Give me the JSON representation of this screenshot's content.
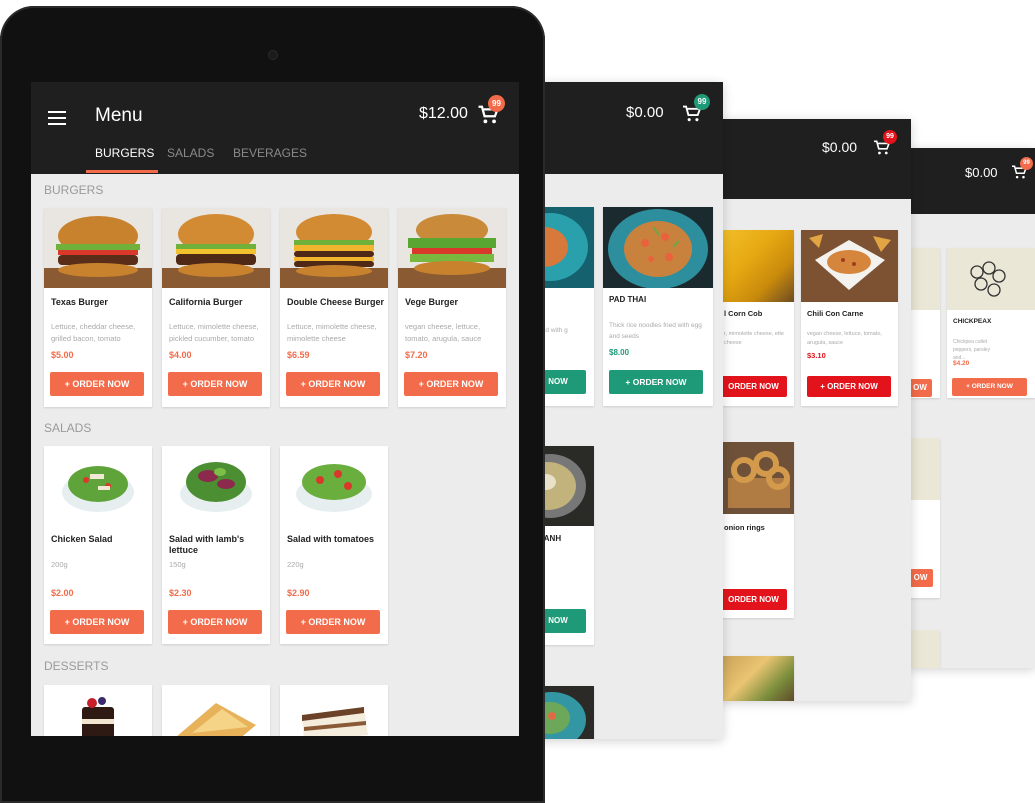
{
  "main": {
    "title": "Menu",
    "cart_total": "$12.00",
    "cart_badge": "99",
    "tabs": [
      "BURGERS",
      "SALADS",
      "BEVERAGES"
    ],
    "sections": {
      "burgers": "BURGERS",
      "salads": "SALADS",
      "desserts": "DESSERTS"
    },
    "order_label": "+ ORDER NOW",
    "burgers": [
      {
        "name": "Texas Burger",
        "desc": "Lettuce, cheddar cheese, grilled bacon, tomato",
        "price": "$5.00"
      },
      {
        "name": "California Burger",
        "desc": "Lettuce, mimolette cheese, pickled cucumber, tomato",
        "price": "$4.00"
      },
      {
        "name": "Double Cheese Burger",
        "desc": "Lettuce, mimolette cheese, mimolette cheese",
        "price": "$6.59"
      },
      {
        "name": "Vege Burger",
        "desc": "vegan cheese, lettuce, tomato, arugula, sauce",
        "price": "$7.20"
      }
    ],
    "salads": [
      {
        "name": "Chicken Salad",
        "desc": "200g",
        "price": "$2.00"
      },
      {
        "name": "Salad with lamb's lettuce",
        "desc": "150g",
        "price": "$2.30"
      },
      {
        "name": "Salad with tomatoes",
        "desc": "220g",
        "price": "$2.90"
      }
    ]
  },
  "screen2": {
    "cart_total": "$0.00",
    "cart_badge": "99",
    "accent": "#1e9a78",
    "order_label": "+ ORDER NOW",
    "partial_btn": "NOW",
    "item1": {
      "desc": "rned with g"
    },
    "item2": {
      "name": "PAD THAI",
      "desc": "Thick rice noodles fried with egg and seeds",
      "price": "$8.00"
    },
    "item3": {
      "name": "HANH"
    }
  },
  "screen3": {
    "cart_total": "$0.00",
    "cart_badge": "99",
    "accent": "#e3131b",
    "order_label": "+ ORDER NOW",
    "partial_btn": "ORDER NOW",
    "item1": {
      "name": "l Corn Cob",
      "desc": "r, mimolette cheese, ette cheese"
    },
    "item2": {
      "name": "Chili Con Carne",
      "desc": "vegan cheese, lettuce, tomato, arugula, sauce",
      "price": "$3.10"
    },
    "item3": {
      "name": "onion rings"
    }
  },
  "screen4": {
    "cart_total": "$0.00",
    "cart_badge": "99",
    "accent": "#f26b4a",
    "order_label": "+ ORDER NOW",
    "partial_btn": "OW",
    "partial_btn2": "OW",
    "item2": {
      "name": "CHICKPEAX",
      "desc": "Chickpea cutlet peppers, parsley and...",
      "price": "$4.20"
    }
  }
}
